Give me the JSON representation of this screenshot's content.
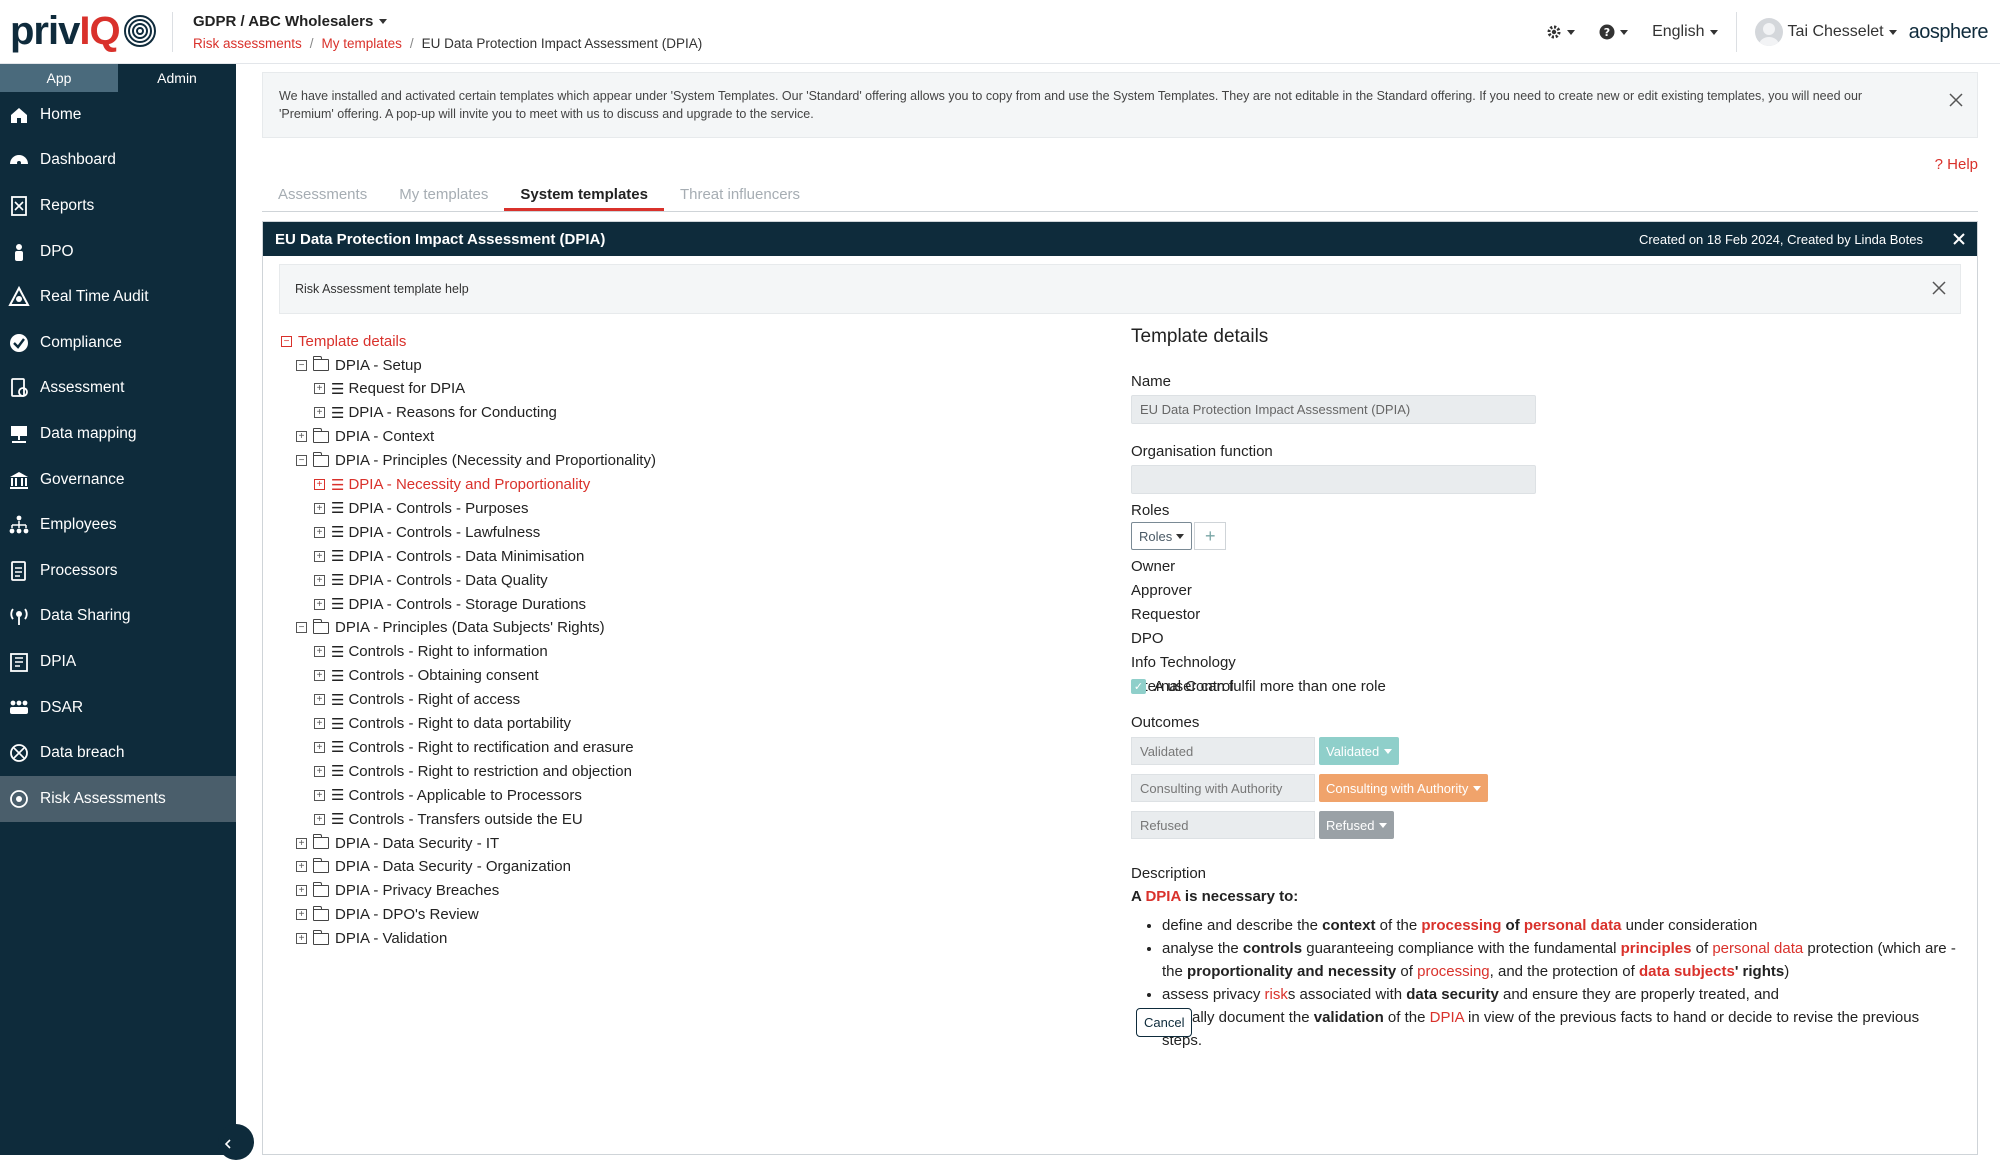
{
  "header": {
    "logo_text": "privIQ",
    "org_selector": "GDPR / ABC Wholesalers",
    "breadcrumbs": [
      "Risk assessments",
      "My templates",
      "EU Data Protection Impact Assessment (DPIA)"
    ],
    "language": "English",
    "user_name": "Tai Chesselet",
    "brand": "aosphere"
  },
  "sidebar": {
    "tabs": [
      "App",
      "Admin"
    ],
    "items": [
      {
        "label": "Home",
        "icon": "home-icon"
      },
      {
        "label": "Dashboard",
        "icon": "dashboard-icon"
      },
      {
        "label": "Reports",
        "icon": "reports-icon"
      },
      {
        "label": "DPO",
        "icon": "dpo-icon"
      },
      {
        "label": "Real Time Audit",
        "icon": "audit-icon"
      },
      {
        "label": "Compliance",
        "icon": "compliance-icon"
      },
      {
        "label": "Assessment",
        "icon": "assessment-icon"
      },
      {
        "label": "Data mapping",
        "icon": "data-mapping-icon"
      },
      {
        "label": "Governance",
        "icon": "governance-icon"
      },
      {
        "label": "Employees",
        "icon": "employees-icon"
      },
      {
        "label": "Processors",
        "icon": "processors-icon"
      },
      {
        "label": "Data Sharing",
        "icon": "data-sharing-icon"
      },
      {
        "label": "DPIA",
        "icon": "dpia-icon"
      },
      {
        "label": "DSAR",
        "icon": "dsar-icon"
      },
      {
        "label": "Data breach",
        "icon": "data-breach-icon"
      },
      {
        "label": "Risk Assessments",
        "icon": "risk-assessments-icon"
      }
    ]
  },
  "notice": {
    "text": "We have installed and activated certain templates which appear under 'System Templates. Our 'Standard' offering allows you to copy from and use the System Templates. They are not editable in the Standard offering. If you need to create new or edit existing templates, you will need our 'Premium' offering. A pop-up will invite you to meet with us to discuss and upgrade to the service."
  },
  "help_link": "Help",
  "tabs": [
    "Assessments",
    "My templates",
    "System templates",
    "Threat influencers"
  ],
  "panel": {
    "title": "EU Data Protection Impact Assessment (DPIA)",
    "meta": "Created on 18 Feb 2024, Created by Linda Botes",
    "help_text": "Risk Assessment template help"
  },
  "tree": {
    "root": "Template details",
    "nodes": [
      {
        "label": "DPIA - Setup",
        "type": "folder",
        "level": 1,
        "expanded": true
      },
      {
        "label": "Request for DPIA",
        "type": "list",
        "level": 2
      },
      {
        "label": "DPIA - Reasons for Conducting",
        "type": "list",
        "level": 2
      },
      {
        "label": "DPIA - Context",
        "type": "folder",
        "level": 1,
        "expanded": false
      },
      {
        "label": "DPIA - Principles (Necessity and Proportionality)",
        "type": "folder",
        "level": 1,
        "expanded": true
      },
      {
        "label": "DPIA - Necessity and Proportionality",
        "type": "list",
        "level": 2,
        "selected": true
      },
      {
        "label": "DPIA - Controls - Purposes",
        "type": "list",
        "level": 2
      },
      {
        "label": "DPIA - Controls - Lawfulness",
        "type": "list",
        "level": 2
      },
      {
        "label": "DPIA - Controls - Data Minimisation",
        "type": "list",
        "level": 2
      },
      {
        "label": "DPIA - Controls - Data Quality",
        "type": "list",
        "level": 2
      },
      {
        "label": "DPIA - Controls - Storage Durations",
        "type": "list",
        "level": 2
      },
      {
        "label": "DPIA - Principles (Data Subjects' Rights)",
        "type": "folder",
        "level": 1,
        "expanded": true
      },
      {
        "label": "Controls - Right to information",
        "type": "list",
        "level": 2
      },
      {
        "label": "Controls - Obtaining consent",
        "type": "list",
        "level": 2
      },
      {
        "label": "Controls - Right of access",
        "type": "list",
        "level": 2
      },
      {
        "label": "Controls - Right to data portability",
        "type": "list",
        "level": 2
      },
      {
        "label": "Controls - Right to rectification and erasure",
        "type": "list",
        "level": 2
      },
      {
        "label": "Controls - Right to restriction and objection",
        "type": "list",
        "level": 2
      },
      {
        "label": "Controls - Applicable to Processors",
        "type": "list",
        "level": 2
      },
      {
        "label": "Controls - Transfers outside the EU",
        "type": "list",
        "level": 2
      },
      {
        "label": "DPIA - Data Security - IT",
        "type": "folder",
        "level": 1,
        "expanded": false
      },
      {
        "label": "DPIA - Data Security - Organization",
        "type": "folder",
        "level": 1,
        "expanded": false
      },
      {
        "label": "DPIA - Privacy Breaches",
        "type": "folder",
        "level": 1,
        "expanded": false
      },
      {
        "label": "DPIA - DPO's Review",
        "type": "folder",
        "level": 1,
        "expanded": false
      },
      {
        "label": "DPIA - Validation",
        "type": "folder",
        "level": 1,
        "expanded": false
      }
    ]
  },
  "details": {
    "title": "Template details",
    "name_label": "Name",
    "name_value": "EU Data Protection Impact Assessment (DPIA)",
    "org_function_label": "Organisation function",
    "org_function_value": "",
    "roles_label": "Roles",
    "roles_button": "Roles",
    "roles": [
      "Owner",
      "Approver",
      "Requestor",
      "DPO",
      "Info Technology",
      "Internal Control"
    ],
    "multi_role_label": "A user can fulfil more than one role",
    "multi_role_checked": true,
    "outcomes_label": "Outcomes",
    "outcomes": [
      {
        "value": "Validated",
        "button": "Validated",
        "color": "#8fcfca"
      },
      {
        "value": "Consulting with Authority",
        "button": "Consulting with Authority",
        "color": "#f0a36b"
      },
      {
        "value": "Refused",
        "button": "Refused",
        "color": "#9aa1a6"
      }
    ],
    "description_label": "Description",
    "cancel_button": "Cancel"
  },
  "colors": {
    "accent": "#d9312b",
    "sidebar_bg": "#0e2b3b"
  }
}
